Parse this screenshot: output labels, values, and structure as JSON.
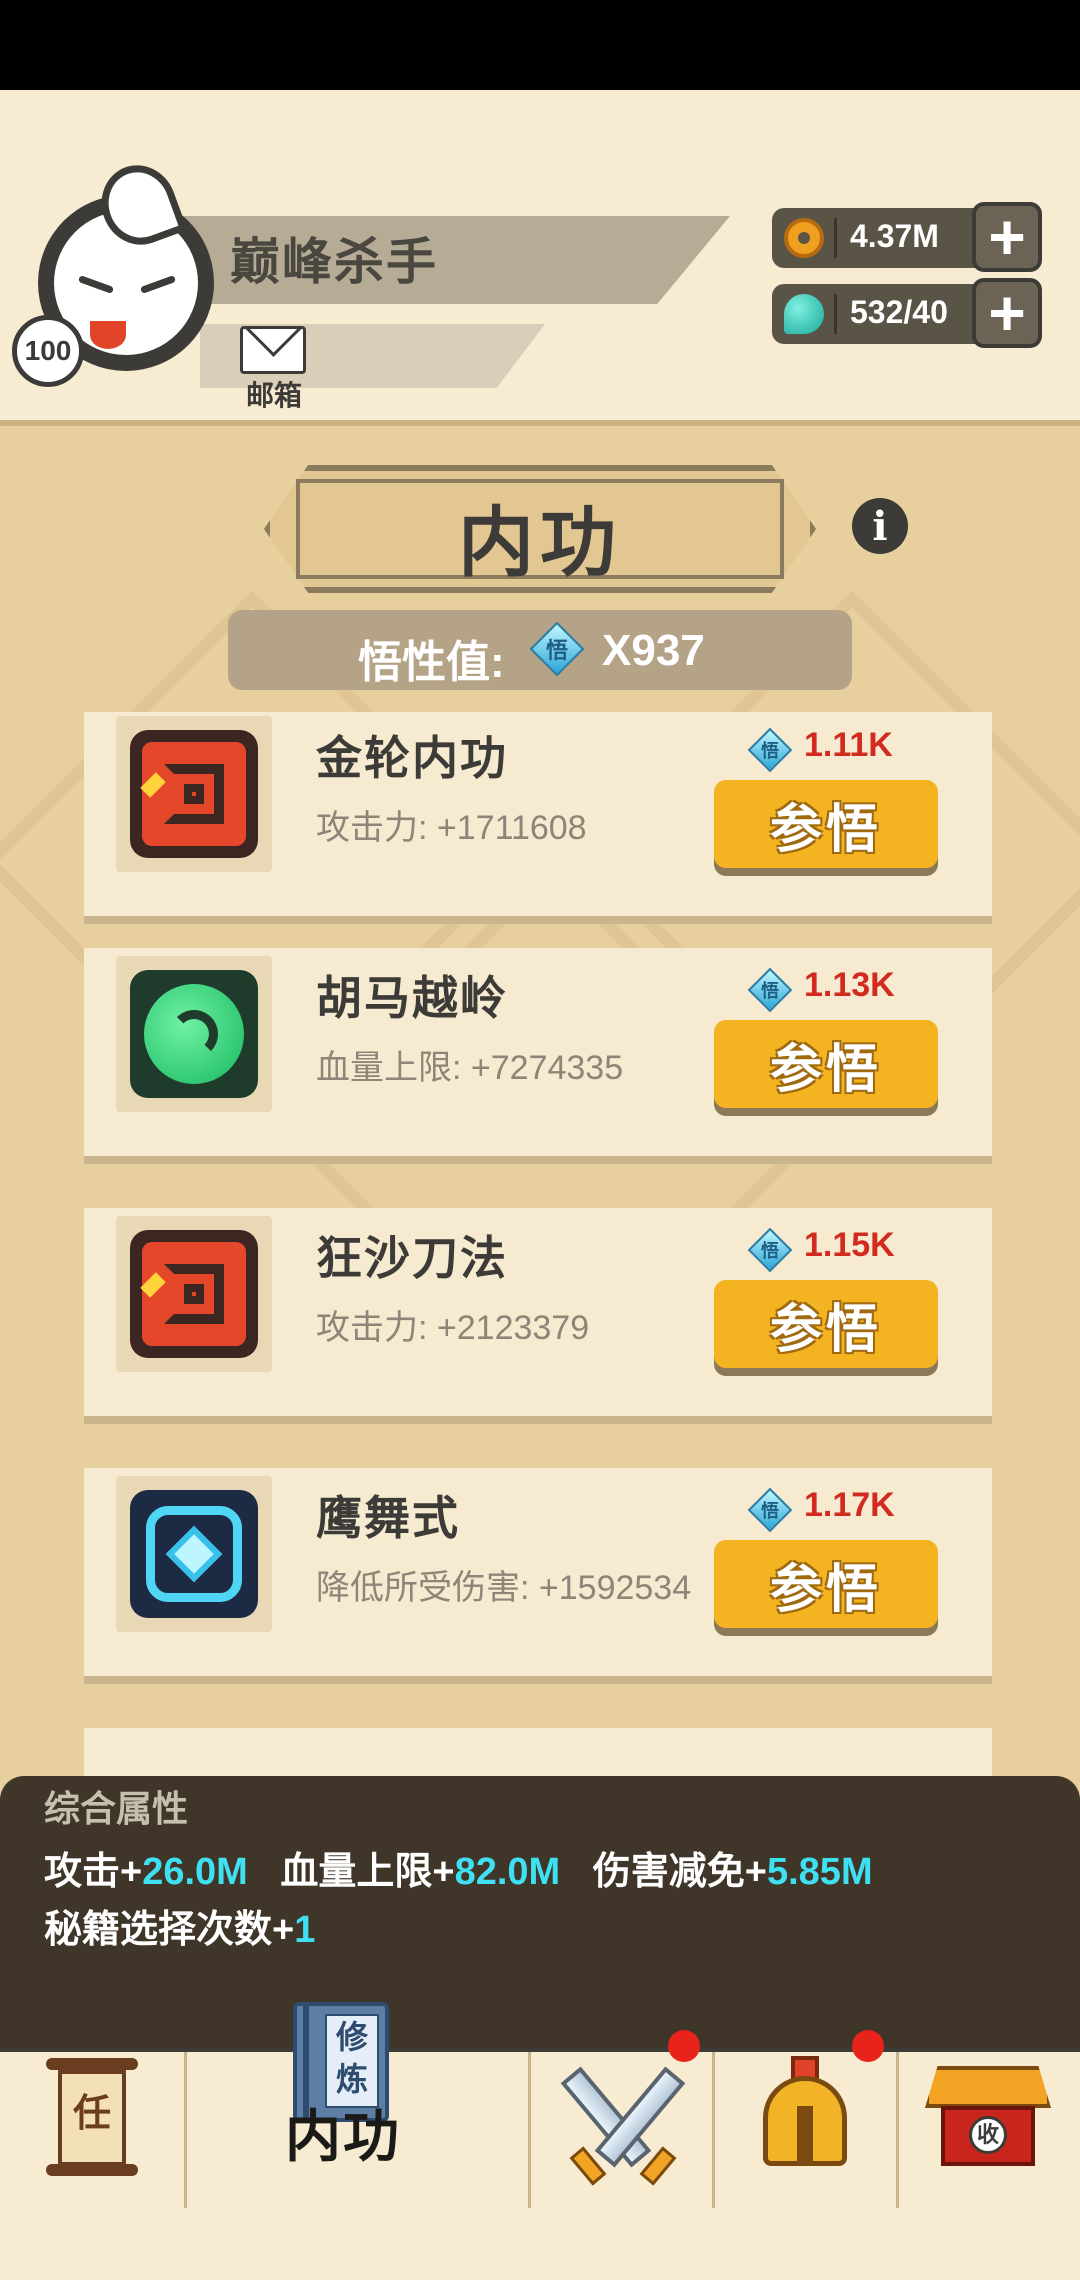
{
  "header": {
    "player_name": "巅峰杀手",
    "level": "100",
    "mail_label": "邮箱",
    "gold": {
      "icon": "gold-coin-icon",
      "value": "4.37M"
    },
    "energy": {
      "icon": "green-gem-icon",
      "value": "532/40"
    },
    "plus_symbol": "+"
  },
  "panel": {
    "title": "内功",
    "info_symbol": "i",
    "insight_label": "悟性值:",
    "insight_gem_char": "悟",
    "insight_value": "X937"
  },
  "skills": [
    {
      "name": "金轮内功",
      "stat": "攻击力: +1711608",
      "cost": "1.11K",
      "button": "参悟",
      "icon": "flame-spiral-icon"
    },
    {
      "name": "胡马越岭",
      "stat": "血量上限: +7274335",
      "cost": "1.13K",
      "button": "参悟",
      "icon": "green-swirl-icon"
    },
    {
      "name": "狂沙刀法",
      "stat": "攻击力: +2123379",
      "cost": "1.15K",
      "button": "参悟",
      "icon": "flame-spiral-icon"
    },
    {
      "name": "鹰舞式",
      "stat": "降低所受伤害: +1592534",
      "cost": "1.17K",
      "button": "参悟",
      "icon": "ice-diamond-icon"
    }
  ],
  "summary": {
    "title": "综合属性",
    "attack_label": "攻击+",
    "attack_value": "26.0M",
    "hp_label": "血量上限+",
    "hp_value": "82.0M",
    "dmg_label": "伤害减免+",
    "dmg_value": "5.85M",
    "choice_label": "秘籍选择次数+",
    "choice_value": "1"
  },
  "tabs": {
    "task_char": "任",
    "book_chars": "修炼",
    "active_label": "内功",
    "shop_char": "收"
  },
  "colors": {
    "accent_orange": "#f4b321",
    "cost_red": "#d22a1f",
    "highlight_cyan": "#3fe0f2",
    "notification_red": "#e8231c"
  }
}
